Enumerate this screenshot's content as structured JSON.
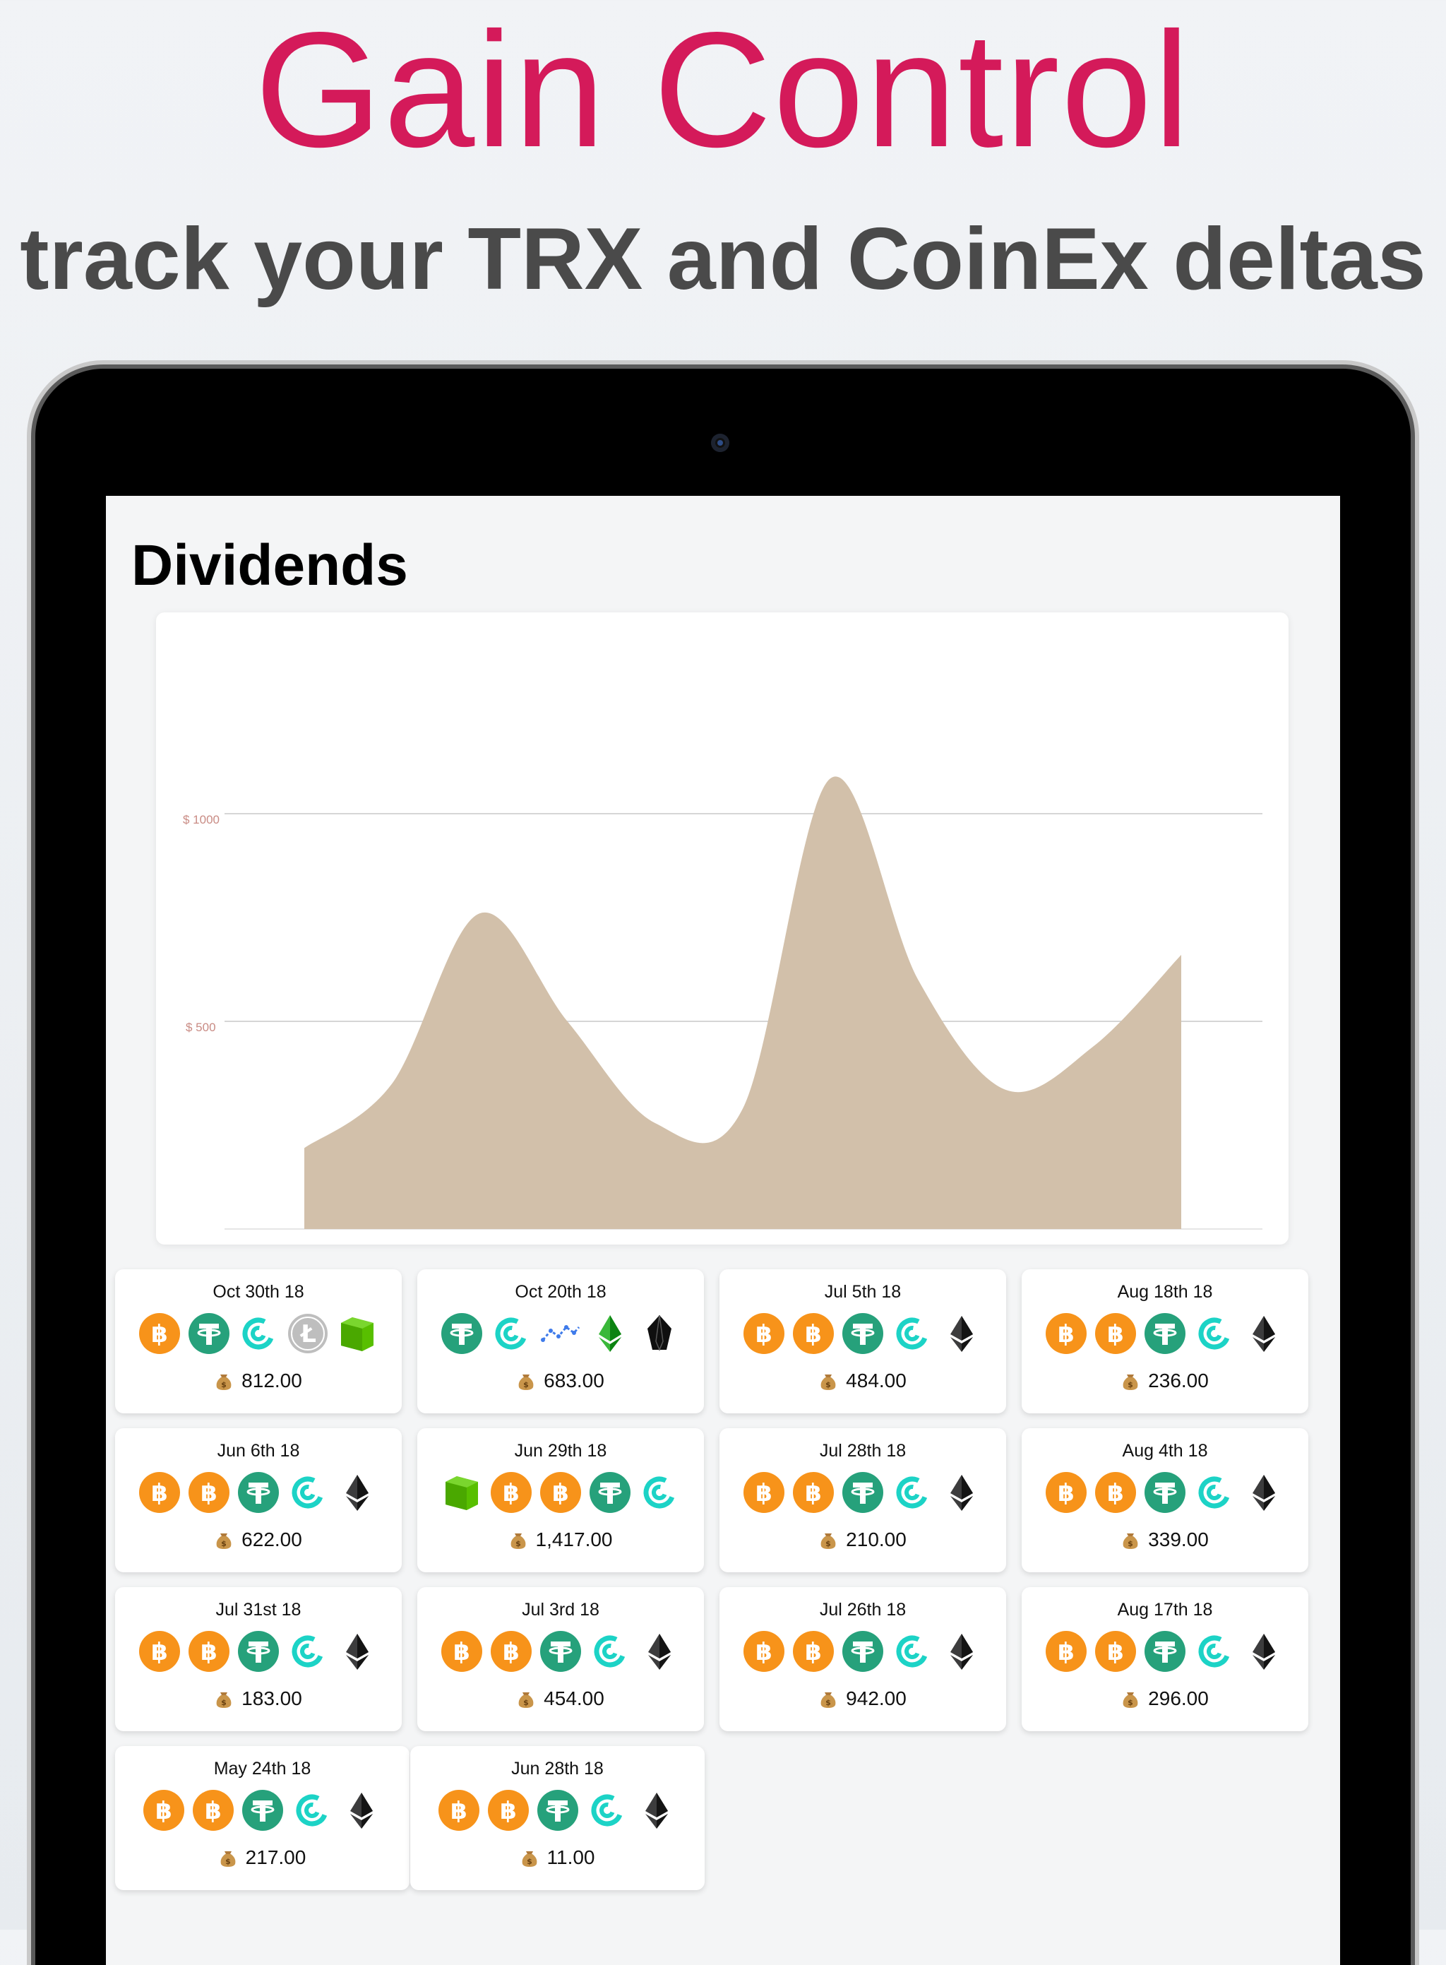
{
  "header": {
    "headline": "Gain Control",
    "subline": "track your TRX and CoinEx deltas"
  },
  "screen": {
    "title": "Dividends"
  },
  "chart_data": {
    "type": "area",
    "title": "",
    "xlabel": "",
    "ylabel": "",
    "ylim": [
      0,
      1000
    ],
    "ytick_labels": [
      "$ 500",
      "$ 1000"
    ],
    "x": [
      0,
      1,
      2,
      3,
      4,
      5,
      6,
      7,
      8,
      9,
      10
    ],
    "values": [
      195,
      350,
      760,
      500,
      255,
      290,
      1085,
      600,
      335,
      440,
      660
    ],
    "fill_color": "#d2c0aa",
    "grid": true
  },
  "dividends": [
    {
      "date": "Oct 30th 18",
      "amount": "812.00",
      "coins": [
        "bitcoin-icon",
        "tether-icon",
        "coinex-icon",
        "litecoin-icon",
        "neo-icon"
      ]
    },
    {
      "date": "Oct 20th 18",
      "amount": "683.00",
      "coins": [
        "tether-icon",
        "coinex-icon",
        "waves-icon",
        "ethereum-classic-icon",
        "eos-icon"
      ]
    },
    {
      "date": "Jul 5th 18",
      "amount": "484.00",
      "coins": [
        "bitcoin-icon",
        "bitcoin-icon",
        "tether-icon",
        "coinex-icon",
        "ethereum-icon"
      ]
    },
    {
      "date": "Aug 18th 18",
      "amount": "236.00",
      "coins": [
        "bitcoin-icon",
        "bitcoin-icon",
        "tether-icon",
        "coinex-icon",
        "ethereum-icon"
      ]
    },
    {
      "date": "Jun 6th 18",
      "amount": "622.00",
      "coins": [
        "bitcoin-icon",
        "bitcoin-icon",
        "tether-icon",
        "coinex-icon",
        "ethereum-icon"
      ]
    },
    {
      "date": "Jun 29th 18",
      "amount": "1,417.00",
      "coins": [
        "neo-icon",
        "bitcoin-icon",
        "bitcoin-icon",
        "tether-icon",
        "coinex-icon"
      ]
    },
    {
      "date": "Jul 28th 18",
      "amount": "210.00",
      "coins": [
        "bitcoin-icon",
        "bitcoin-icon",
        "tether-icon",
        "coinex-icon",
        "ethereum-icon"
      ]
    },
    {
      "date": "Aug 4th 18",
      "amount": "339.00",
      "coins": [
        "bitcoin-icon",
        "bitcoin-icon",
        "tether-icon",
        "coinex-icon",
        "ethereum-icon"
      ]
    },
    {
      "date": "Jul 31st 18",
      "amount": "183.00",
      "coins": [
        "bitcoin-icon",
        "bitcoin-icon",
        "tether-icon",
        "coinex-icon",
        "ethereum-icon"
      ]
    },
    {
      "date": "Jul 3rd 18",
      "amount": "454.00",
      "coins": [
        "bitcoin-icon",
        "bitcoin-icon",
        "tether-icon",
        "coinex-icon",
        "ethereum-icon"
      ]
    },
    {
      "date": "Jul 26th 18",
      "amount": "942.00",
      "coins": [
        "bitcoin-icon",
        "bitcoin-icon",
        "tether-icon",
        "coinex-icon",
        "ethereum-icon"
      ]
    },
    {
      "date": "Aug 17th 18",
      "amount": "296.00",
      "coins": [
        "bitcoin-icon",
        "bitcoin-icon",
        "tether-icon",
        "coinex-icon",
        "ethereum-icon"
      ]
    },
    {
      "date": "May 24th 18",
      "amount": "217.00",
      "coins": [
        "bitcoin-icon",
        "bitcoin-icon",
        "tether-icon",
        "coinex-icon",
        "ethereum-icon"
      ]
    },
    {
      "date": "Jun 28th 18",
      "amount": "11.00",
      "coins": [
        "bitcoin-icon",
        "bitcoin-icon",
        "tether-icon",
        "coinex-icon",
        "ethereum-icon"
      ]
    }
  ],
  "colors": {
    "headline": "#d41a5a",
    "subline": "#4a4a4a",
    "bitcoin": "#f7931a",
    "tether": "#26a17b",
    "coinex": "#1cd3c6",
    "neo": "#58bf00",
    "litecoin": "#bebebe",
    "axis_label": "#c98b84"
  }
}
